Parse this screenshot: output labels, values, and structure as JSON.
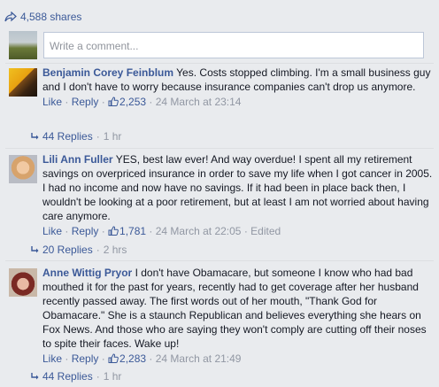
{
  "shares": {
    "label": "4,588 shares",
    "icon": "share-arrow-icon"
  },
  "composer": {
    "placeholder": "Write a comment..."
  },
  "comments": [
    {
      "author": "Benjamin Corey Feinblum",
      "text": "Yes. Costs stopped climbing. I'm a small business guy and I don't have to worry because insurance companies can't drop us anymore.",
      "like": "Like",
      "reply": "Reply",
      "likes": "2,253",
      "date": "24 March at 23:14",
      "edited": "",
      "replies": "44 Replies",
      "replies_age": "1 hr"
    },
    {
      "author": "Lili Ann Fuller",
      "text": "YES, best law ever! And way overdue! I spent all my retirement savings on overpriced insurance in order to save my life when I got cancer in 2005. I had no income and now have no savings. If it had been in place back then, I wouldn't be looking at a poor retirement, but at least I am not worried about having care anymore.",
      "like": "Like",
      "reply": "Reply",
      "likes": "1,781",
      "date": "24 March at 22:05",
      "edited": "Edited",
      "replies": "20 Replies",
      "replies_age": "2 hrs"
    },
    {
      "author": "Anne Wittig Pryor",
      "text": "I don't have Obamacare, but someone I know who had bad mouthed it for the past for years, recently had to get coverage after her husband recently passed away. The first words out of her mouth, \"Thank God for Obamacare.\" She is a staunch Republican and believes everything she hears on Fox News. And those who are saying they won't comply are cutting off their noses to spite their faces. Wake up!",
      "like": "Like",
      "reply": "Reply",
      "likes": "2,283",
      "date": "24 March at 21:49",
      "edited": "",
      "replies": "44 Replies",
      "replies_age": "1 hr"
    }
  ]
}
